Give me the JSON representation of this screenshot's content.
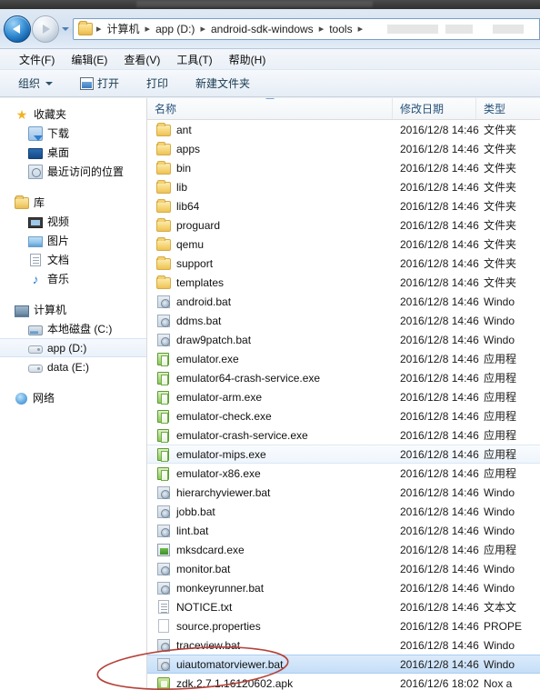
{
  "window": {
    "title_strip_visible": true
  },
  "navigation": {
    "back_button": "back-arrow",
    "forward_button": "forward-arrow",
    "history_dropdown": "history-caret",
    "breadcrumbs": [
      "计算机",
      "app (D:)",
      "android-sdk-windows",
      "tools"
    ],
    "separator": "▸"
  },
  "menubar": {
    "items": [
      "文件(F)",
      "编辑(E)",
      "查看(V)",
      "工具(T)",
      "帮助(H)"
    ]
  },
  "toolbar": {
    "organize": "组织",
    "open": "打开",
    "print": "打印",
    "new_folder": "新建文件夹"
  },
  "sidebar": {
    "groups": [
      {
        "header": {
          "label": "收藏夹",
          "icon": "star-icon"
        },
        "items": [
          {
            "label": "下载",
            "icon": "download-icon"
          },
          {
            "label": "桌面",
            "icon": "desktop-icon"
          },
          {
            "label": "最近访问的位置",
            "icon": "recent-places-icon"
          }
        ]
      },
      {
        "header": {
          "label": "库",
          "icon": "library-icon"
        },
        "items": [
          {
            "label": "视频",
            "icon": "video-icon"
          },
          {
            "label": "图片",
            "icon": "picture-icon"
          },
          {
            "label": "文档",
            "icon": "document-icon"
          },
          {
            "label": "音乐",
            "icon": "music-icon"
          }
        ]
      },
      {
        "header": {
          "label": "计算机",
          "icon": "computer-icon"
        },
        "items": [
          {
            "label": "本地磁盘 (C:)",
            "icon": "harddisk-icon",
            "selected": false
          },
          {
            "label": "app (D:)",
            "icon": "drive-icon",
            "selected": true
          },
          {
            "label": "data (E:)",
            "icon": "drive-icon",
            "selected": false
          }
        ]
      },
      {
        "header": {
          "label": "网络",
          "icon": "network-icon"
        },
        "items": []
      }
    ]
  },
  "filelist": {
    "columns": {
      "name": "名称",
      "date": "修改日期",
      "type": "类型"
    },
    "sort": {
      "column": "名称",
      "direction": "ascending"
    },
    "rows": [
      {
        "name": "ant",
        "date": "2016/12/8 14:46",
        "type": "文件夹",
        "icon": "folder-icon",
        "state": "normal"
      },
      {
        "name": "apps",
        "date": "2016/12/8 14:46",
        "type": "文件夹",
        "icon": "folder-icon",
        "state": "normal"
      },
      {
        "name": "bin",
        "date": "2016/12/8 14:46",
        "type": "文件夹",
        "icon": "folder-icon",
        "state": "normal"
      },
      {
        "name": "lib",
        "date": "2016/12/8 14:46",
        "type": "文件夹",
        "icon": "folder-icon",
        "state": "normal"
      },
      {
        "name": "lib64",
        "date": "2016/12/8 14:46",
        "type": "文件夹",
        "icon": "folder-icon",
        "state": "normal"
      },
      {
        "name": "proguard",
        "date": "2016/12/8 14:46",
        "type": "文件夹",
        "icon": "folder-icon",
        "state": "normal"
      },
      {
        "name": "qemu",
        "date": "2016/12/8 14:46",
        "type": "文件夹",
        "icon": "folder-icon",
        "state": "normal"
      },
      {
        "name": "support",
        "date": "2016/12/8 14:46",
        "type": "文件夹",
        "icon": "folder-icon",
        "state": "normal"
      },
      {
        "name": "templates",
        "date": "2016/12/8 14:46",
        "type": "文件夹",
        "icon": "folder-icon",
        "state": "normal"
      },
      {
        "name": "android.bat",
        "date": "2016/12/8 14:46",
        "type": "Windo",
        "icon": "bat-icon",
        "state": "normal"
      },
      {
        "name": "ddms.bat",
        "date": "2016/12/8 14:46",
        "type": "Windo",
        "icon": "bat-icon",
        "state": "normal"
      },
      {
        "name": "draw9patch.bat",
        "date": "2016/12/8 14:46",
        "type": "Windo",
        "icon": "bat-icon",
        "state": "normal"
      },
      {
        "name": "emulator.exe",
        "date": "2016/12/8 14:46",
        "type": "应用程",
        "icon": "exe-icon",
        "state": "normal"
      },
      {
        "name": "emulator64-crash-service.exe",
        "date": "2016/12/8 14:46",
        "type": "应用程",
        "icon": "exe-icon",
        "state": "normal"
      },
      {
        "name": "emulator-arm.exe",
        "date": "2016/12/8 14:46",
        "type": "应用程",
        "icon": "exe-icon",
        "state": "normal"
      },
      {
        "name": "emulator-check.exe",
        "date": "2016/12/8 14:46",
        "type": "应用程",
        "icon": "exe-icon",
        "state": "normal"
      },
      {
        "name": "emulator-crash-service.exe",
        "date": "2016/12/8 14:46",
        "type": "应用程",
        "icon": "exe-icon",
        "state": "normal"
      },
      {
        "name": "emulator-mips.exe",
        "date": "2016/12/8 14:46",
        "type": "应用程",
        "icon": "exe-icon",
        "state": "hover"
      },
      {
        "name": "emulator-x86.exe",
        "date": "2016/12/8 14:46",
        "type": "应用程",
        "icon": "exe-icon",
        "state": "normal"
      },
      {
        "name": "hierarchyviewer.bat",
        "date": "2016/12/8 14:46",
        "type": "Windo",
        "icon": "bat-icon",
        "state": "normal"
      },
      {
        "name": "jobb.bat",
        "date": "2016/12/8 14:46",
        "type": "Windo",
        "icon": "bat-icon",
        "state": "normal"
      },
      {
        "name": "lint.bat",
        "date": "2016/12/8 14:46",
        "type": "Windo",
        "icon": "bat-icon",
        "state": "normal"
      },
      {
        "name": "mksdcard.exe",
        "date": "2016/12/8 14:46",
        "type": "应用程",
        "icon": "exe2-icon",
        "state": "normal"
      },
      {
        "name": "monitor.bat",
        "date": "2016/12/8 14:46",
        "type": "Windo",
        "icon": "bat-icon",
        "state": "normal"
      },
      {
        "name": "monkeyrunner.bat",
        "date": "2016/12/8 14:46",
        "type": "Windo",
        "icon": "bat-icon",
        "state": "normal"
      },
      {
        "name": "NOTICE.txt",
        "date": "2016/12/8 14:46",
        "type": "文本文",
        "icon": "text-icon",
        "state": "normal"
      },
      {
        "name": "source.properties",
        "date": "2016/12/8 14:46",
        "type": "PROPE",
        "icon": "blank-file-icon",
        "state": "normal"
      },
      {
        "name": "traceview.bat",
        "date": "2016/12/8 14:46",
        "type": "Windo",
        "icon": "bat-icon",
        "state": "normal"
      },
      {
        "name": "uiautomatorviewer.bat",
        "date": "2016/12/8 14:46",
        "type": "Windo",
        "icon": "bat-icon",
        "state": "selected"
      },
      {
        "name": "zdk.2.7.1.16120602.apk",
        "date": "2016/12/6 18:02",
        "type": "Nox a",
        "icon": "apk-icon",
        "state": "normal"
      }
    ]
  },
  "annotation": {
    "shape": "red-ellipse",
    "color": "#c0392b",
    "target_row": "uiautomatorviewer.bat"
  },
  "colors": {
    "selection_blue": "#c4def8",
    "accent": "#27527a",
    "annotation_red": "#c0392b"
  }
}
